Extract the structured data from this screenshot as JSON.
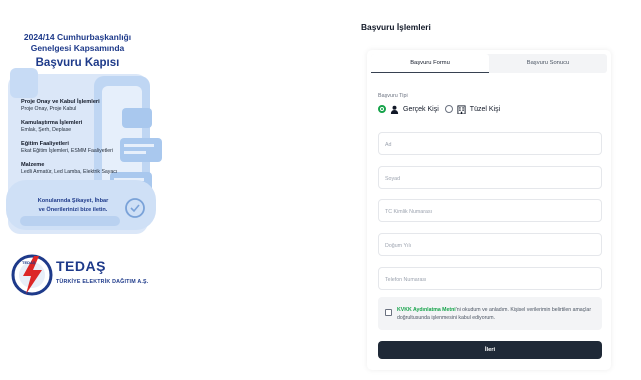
{
  "left_panel": {
    "title_line1": "2024/14 Cumhurbaşkanlığı",
    "title_line2": "Genelgesi Kapsamında",
    "title_line3": "Başvuru Kapısı",
    "features": [
      {
        "title": "Proje Onay ve Kabul İşlemleri",
        "desc": "Proje Onay, Proje Kabul"
      },
      {
        "title": "Kamulaştırma İşlemleri",
        "desc": "Emlak, Şerh, Deplase"
      },
      {
        "title": "Eğitim Faaliyetleri",
        "desc": "Ekat Eğitim İşlemleri, ESMM Faaliyetleri"
      },
      {
        "title": "Malzeme",
        "desc": "Ledli Armatür, Led Lamba, Elektrik Sayacı"
      }
    ],
    "complaint_line1": "Konularında  Şikayet, İhbar",
    "complaint_line2": "ve Önerilerinizi bize iletin."
  },
  "brand": {
    "name": "TEDAŞ",
    "subtitle": "TÜRKİYE ELEKTRİK DAĞITIM A.Ş.",
    "logo_text": "TEDAŞ"
  },
  "page_title": "Başvuru İşlemleri",
  "tabs": [
    {
      "label": "Başvuru Formu",
      "active": true
    },
    {
      "label": "Başvuru Sonucu",
      "active": false
    }
  ],
  "form": {
    "type_label": "Başvuru Tipi",
    "types": [
      {
        "label": "Gerçek Kişi",
        "selected": true,
        "icon": "person-icon"
      },
      {
        "label": "Tüzel Kişi",
        "selected": false,
        "icon": "building-icon"
      }
    ],
    "fields": {
      "ad": {
        "placeholder": "Ad",
        "value": ""
      },
      "soyad": {
        "placeholder": "Soyad",
        "value": ""
      },
      "tc": {
        "placeholder": "TC Kimlik Numarası",
        "value": ""
      },
      "dogum": {
        "placeholder": "Doğum Yılı",
        "value": ""
      },
      "telefon": {
        "placeholder": "Telefon Numarası",
        "value": ""
      }
    },
    "consent_link": "KVKK Aydınlatma Metni",
    "consent_text": "'ni okudum ve anladım. Kişisel verilerimin belirtilen amaçlar doğrultusunda işlenmesini kabul ediyorum.",
    "consent_checked": false,
    "submit_label": "İleri"
  },
  "colors": {
    "brand_blue": "#1e3a8a",
    "accent_green": "#16a34a",
    "button_dark": "#1f2937",
    "logo_red": "#dc2626"
  }
}
